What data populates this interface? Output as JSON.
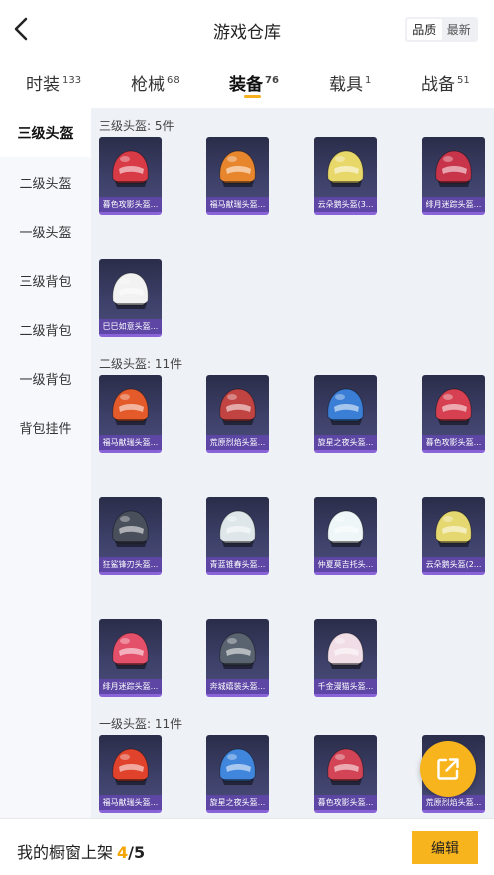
{
  "header": {
    "title": "游戏仓库",
    "back_icon": "back-chevron-icon"
  },
  "sort": {
    "options": [
      "品质",
      "最新"
    ],
    "selected": "品质"
  },
  "tabs": [
    {
      "label": "时装",
      "count": "133"
    },
    {
      "label": "枪械",
      "count": "68"
    },
    {
      "label": "装备",
      "count": "76",
      "active": true
    },
    {
      "label": "载具",
      "count": "1"
    },
    {
      "label": "战备",
      "count": "51"
    }
  ],
  "sidebar": [
    {
      "label": "三级头盔",
      "active": true
    },
    {
      "label": "二级头盔"
    },
    {
      "label": "一级头盔"
    },
    {
      "label": "三级背包"
    },
    {
      "label": "二级背包"
    },
    {
      "label": "一级背包"
    },
    {
      "label": "背包挂件"
    }
  ],
  "sections": [
    {
      "title": "三级头盔: 5件",
      "items": [
        {
          "name": "暮色攻影头盔...",
          "icon": "helmet-icon",
          "color": "#d83a46"
        },
        {
          "name": "福马献瑞头盔...",
          "icon": "helmet-icon",
          "color": "#e8862e"
        },
        {
          "name": "云朵鹅头盔(3...",
          "icon": "helmet-icon",
          "color": "#e8d86a"
        },
        {
          "name": "绯月迷踪头盔...",
          "icon": "helmet-icon",
          "color": "#c8344a"
        },
        {
          "name": "巳巳如意头盔...",
          "icon": "helmet-icon",
          "color": "#f2f2f2"
        }
      ]
    },
    {
      "title": "二级头盔: 11件",
      "items": [
        {
          "name": "福马献瑞头盔...",
          "icon": "helmet-icon",
          "color": "#e45a2a"
        },
        {
          "name": "荒原烈焰头盔...",
          "icon": "helmet-icon",
          "color": "#c24442"
        },
        {
          "name": "旋星之夜头盔...",
          "icon": "helmet-icon",
          "color": "#3a7ed6"
        },
        {
          "name": "暮色攻影头盔...",
          "icon": "helmet-icon",
          "color": "#d64050"
        },
        {
          "name": "狂鲨锋刃头盔...",
          "icon": "helmet-icon",
          "color": "#4a4f5c"
        },
        {
          "name": "青蓝锥春头盔...",
          "icon": "helmet-icon",
          "color": "#dfe6ea"
        },
        {
          "name": "仲夏莫吉托头...",
          "icon": "helmet-icon",
          "color": "#eef6f8"
        },
        {
          "name": "云朵鹅头盔(2...",
          "icon": "helmet-icon",
          "color": "#e6d870"
        },
        {
          "name": "绯月迷踪头盔...",
          "icon": "helmet-icon",
          "color": "#e4506a"
        },
        {
          "name": "奔城嬉装头盔...",
          "icon": "helmet-icon",
          "color": "#5a6470"
        },
        {
          "name": "千金漫猫头盔...",
          "icon": "helmet-icon",
          "color": "#f1dde6"
        }
      ]
    },
    {
      "title": "一级头盔: 11件",
      "items": [
        {
          "name": "福马献瑞头盔...",
          "icon": "helmet-icon",
          "color": "#e0422c"
        },
        {
          "name": "旋星之夜头盔...",
          "icon": "helmet-icon",
          "color": "#3f86dc"
        },
        {
          "name": "暮色攻影头盔...",
          "icon": "helmet-icon",
          "color": "#d24456"
        },
        {
          "name": "荒原烈焰头盔...",
          "icon": "helmet-icon",
          "color": "#b84040"
        }
      ]
    }
  ],
  "fab_icon": "share-external-icon",
  "bottom": {
    "label": "我的橱窗上架",
    "current": "4",
    "separator": "/",
    "max": "5",
    "edit_label": "编辑"
  },
  "colors": {
    "accent": "#f8b41c",
    "card_bottom": "#8b63d8",
    "sidebar_bg": "#f6f8fb",
    "content_bg": "#eef1f6"
  }
}
